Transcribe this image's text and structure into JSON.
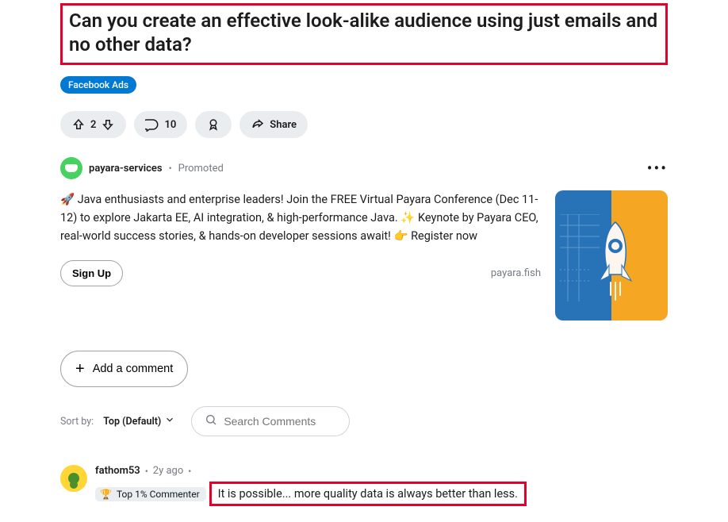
{
  "post": {
    "title": "Can you create an effective look-alike audience using just emails and no other data?",
    "flair": "Facebook Ads"
  },
  "actions": {
    "score": "2",
    "comments": "10",
    "share": "Share"
  },
  "promo": {
    "user": "payara-services",
    "tag": "Promoted",
    "text": "🚀 Java enthusiasts and enterprise leaders! Join the FREE Virtual Payara Conference (Dec 11-12) to explore Jakarta EE, AI integration, & high-performance Java. ✨ Keynote by Payara CEO, real-world success stories, & hands-on developer sessions await! 👉 Register now",
    "cta": "Sign Up",
    "domain": "payara.fish"
  },
  "compose": {
    "add_comment": "Add a comment"
  },
  "sort": {
    "label": "Sort by:",
    "value": "Top (Default)",
    "search_placeholder": "Search Comments"
  },
  "comment": {
    "user": "fathom53",
    "age": "2y ago",
    "badge": "Top 1% Commenter",
    "text": "It is possible... more quality data is always better than less."
  }
}
